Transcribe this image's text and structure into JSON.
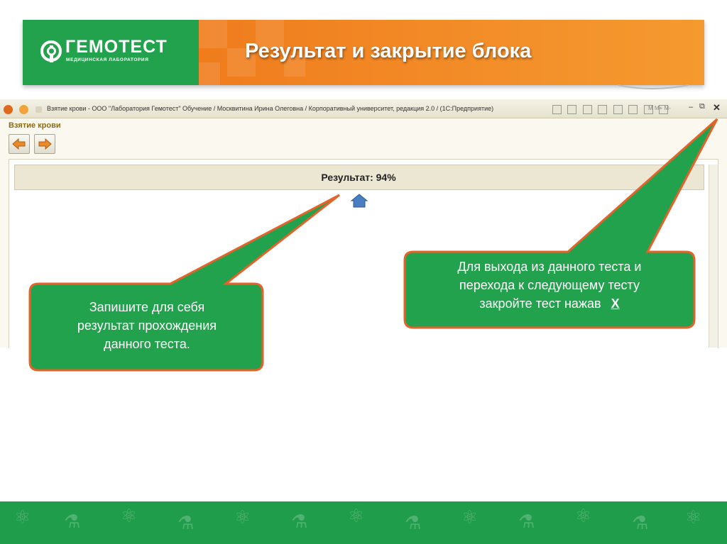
{
  "slide": {
    "title": "Результат и закрытие блока",
    "logo_name": "ГЕМОТЕСТ",
    "logo_subtitle": "МЕДИЦИНСКАЯ ЛАБОРАТОРИЯ"
  },
  "window": {
    "title": "Взятие крови - ООО \"Лаборатория Гемотест\" Обучение / Москвитина Ирина Олеговна / Корпоративный университет, редакция 2.0 / (1С:Предприятие)",
    "toolbar_text": "M M+ M-",
    "minimize_glyph": "–",
    "restore_glyph": "⧉",
    "close_glyph": "✕"
  },
  "form": {
    "title": "Взятие крови",
    "result": "Результат: 94%"
  },
  "callouts": {
    "left_text": [
      "Запишите для себя",
      "результат прохождения",
      "данного теста."
    ],
    "right_text": [
      "Для выхода из данного теста  и",
      "перехода к следующему тесту",
      "закройте  тест  нажав"
    ],
    "close_hint": "X"
  },
  "colors": {
    "green": "#23a24d",
    "orange": "#f28a26",
    "callout_border": "#e4632a"
  },
  "icons": [
    "logo-mark-icon",
    "arrow-left-icon",
    "arrow-right-icon",
    "home-icon",
    "minimize-icon",
    "restore-icon",
    "close-icon"
  ]
}
